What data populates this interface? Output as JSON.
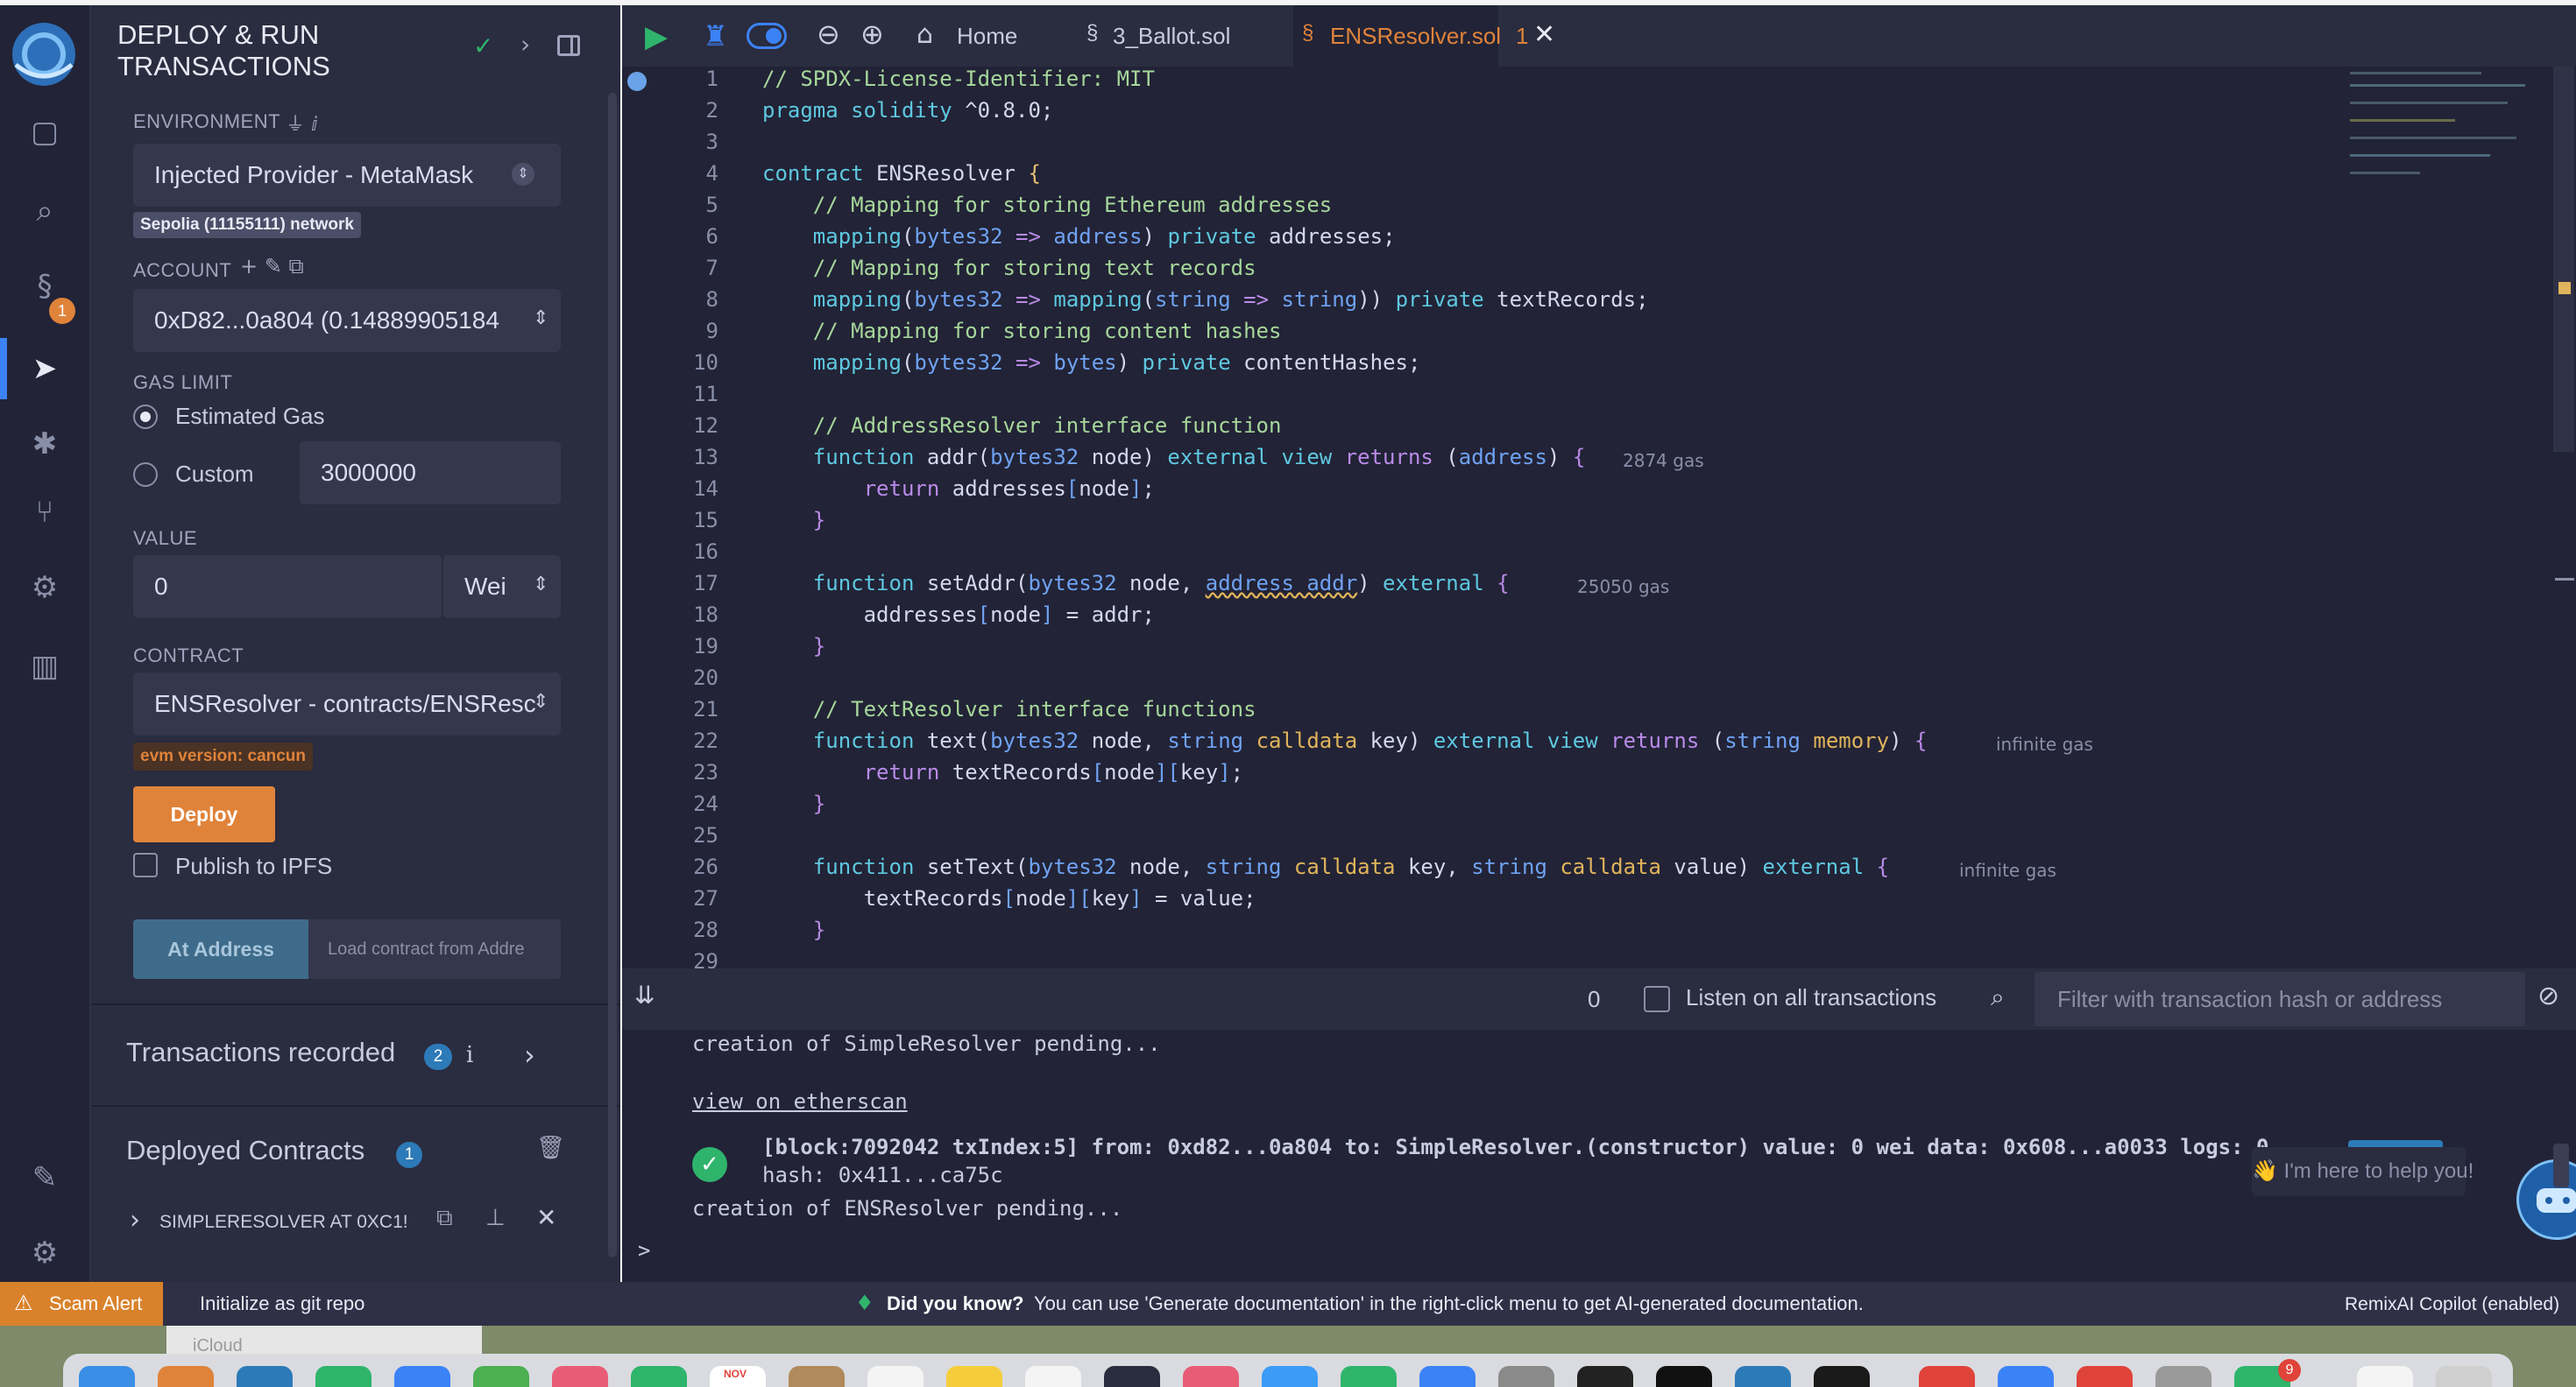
{
  "panel": {
    "title_line1": "DEPLOY & RUN",
    "title_line2": "TRANSACTIONS",
    "environment_label": "ENVIRONMENT",
    "environment_value": "Injected Provider - MetaMask",
    "network_badge": "Sepolia (11155111) network",
    "account_label": "ACCOUNT",
    "account_value": "0xD82...0a804 (0.14889905184",
    "gas_limit_label": "GAS LIMIT",
    "gas_estimated_label": "Estimated Gas",
    "gas_custom_label": "Custom",
    "gas_custom_value": "3000000",
    "value_label": "VALUE",
    "value_amount": "0",
    "value_unit": "Wei",
    "contract_label": "CONTRACT",
    "contract_value": "ENSResolver - contracts/ENSResc",
    "evm_badge": "evm version: cancun",
    "deploy_label": "Deploy",
    "publish_ipfs_label": "Publish to IPFS",
    "at_address_label": "At Address",
    "load_contract_placeholder": "Load contract from Addre",
    "transactions_recorded_label": "Transactions recorded",
    "transactions_recorded_count": "2",
    "deployed_contracts_label": "Deployed Contracts",
    "deployed_contracts_count": "1",
    "deployed_item": "SIMPLERESOLVER AT 0XC1!"
  },
  "rail": {
    "plugin_badge": "1"
  },
  "editor": {
    "tabs": {
      "home": "Home",
      "ballot": "3_Ballot.sol",
      "ens": "ENSResolver.sol",
      "ens_count": "1"
    },
    "line_numbers": [
      "1",
      "2",
      "3",
      "4",
      "5",
      "6",
      "7",
      "8",
      "9",
      "10",
      "11",
      "12",
      "13",
      "14",
      "15",
      "16",
      "17",
      "18",
      "19",
      "20",
      "21",
      "22",
      "23",
      "24",
      "25",
      "26",
      "27",
      "28",
      "29"
    ],
    "gas_hints": {
      "addr": "2874 gas",
      "setAddr": "25050 gas",
      "text": "infinite gas",
      "setText": "infinite gas"
    }
  },
  "terminal": {
    "count": "0",
    "listen_label": "Listen on all transactions",
    "filter_placeholder": "Filter with transaction hash or address",
    "line1": "creation of SimpleResolver pending...",
    "etherscan_link": "view on etherscan",
    "tx_line1": "[block:7092042 txIndex:5] from: 0xd82...0a804 to: SimpleResolver.(constructor) value: 0 wei data: 0x608...a0033 logs: 0",
    "tx_line2": "hash: 0x411...ca75c",
    "line3": "creation of ENSResolver pending...",
    "prompt": ">",
    "help_bubble": "👋 I'm here to help you!"
  },
  "status": {
    "scam_alert": "Scam Alert",
    "git_init": "Initialize as git repo",
    "did_you_know": "Did you know?",
    "tip": "You can use 'Generate documentation' in the right-click menu to get AI-generated documentation.",
    "copilot": "RemixAI Copilot (enabled)"
  },
  "dock": {
    "calendar_month": "NOV",
    "badge": "9",
    "icloud_label": "iCloud"
  },
  "colors": {
    "accent": "#3b82f6",
    "deploy": "#e0833a",
    "at_address": "#3e6b8a",
    "success": "#2fb46c",
    "scam": "#d9822b"
  }
}
